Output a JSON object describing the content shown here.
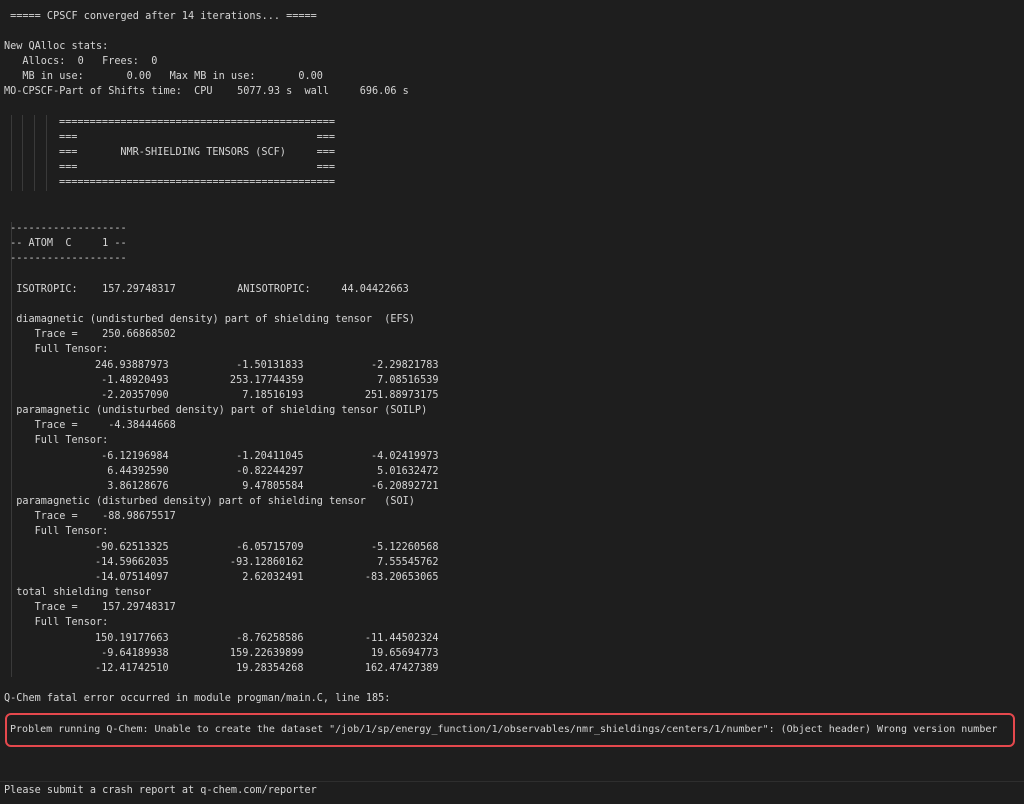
{
  "terminal": {
    "lines": [
      " ===== CPSCF converged after 14 iterations... =====",
      "New QAlloc stats:",
      "   Allocs:  0   Frees:  0",
      "   MB in use:       0.00   Max MB in use:       0.00",
      "MO-CPSCF-Part of Shifts time:  CPU    5077.93 s  wall     696.06 s",
      "=============================================",
      "===                                       ===",
      "===       NMR-SHIELDING TENSORS (SCF)     ===",
      "===                                       ===",
      "=============================================",
      " -------------------",
      " -- ATOM  C     1 --",
      " -------------------",
      "  ISOTROPIC:    157.29748317          ANISOTROPIC:     44.04422663",
      "  diamagnetic (undisturbed density) part of shielding tensor  (EFS)",
      "     Trace =    250.66868502",
      "     Full Tensor:",
      "246.93887973           -1.50131833           -2.29821783",
      " -1.48920493          253.17744359            7.08516539",
      " -2.20357090            7.18516193          251.88973175",
      "  paramagnetic (undisturbed density) part of shielding tensor (SOILP)",
      "     Trace =     -4.38444668",
      "     Full Tensor:",
      " -6.12196984           -1.20411045           -4.02419973",
      "  6.44392590           -0.82244297            5.01632472",
      "  3.86128676            9.47805584           -6.20892721",
      "  paramagnetic (disturbed density) part of shielding tensor   (SOI)",
      "     Trace =    -88.98675517",
      "     Full Tensor:",
      "-90.62513325           -6.05715709           -5.12260568",
      "-14.59662035          -93.12860162            7.55545762",
      "-14.07514097            2.62032491          -83.20653065",
      "  total shielding tensor",
      "     Trace =    157.29748317",
      "     Full Tensor:",
      "150.19177663           -8.76258586          -11.44502324",
      " -9.64189938          159.22639899           19.65694773",
      "-12.41742510           19.28354268          162.47427389",
      "Q-Chem fatal error occurred in module progman/main.C, line 185:",
      " Problem running Q-Chem: Unable to create the dataset \"/job/1/sp/energy_function/1/observables/nmr_shieldings/centers/1/number\": (Object header) Wrong version number",
      "Please submit a crash report at q-chem.com/reporter"
    ]
  },
  "colors": {
    "background": "#1e1e1e",
    "text": "#d6d6d6",
    "highlight": "#e5484d"
  }
}
